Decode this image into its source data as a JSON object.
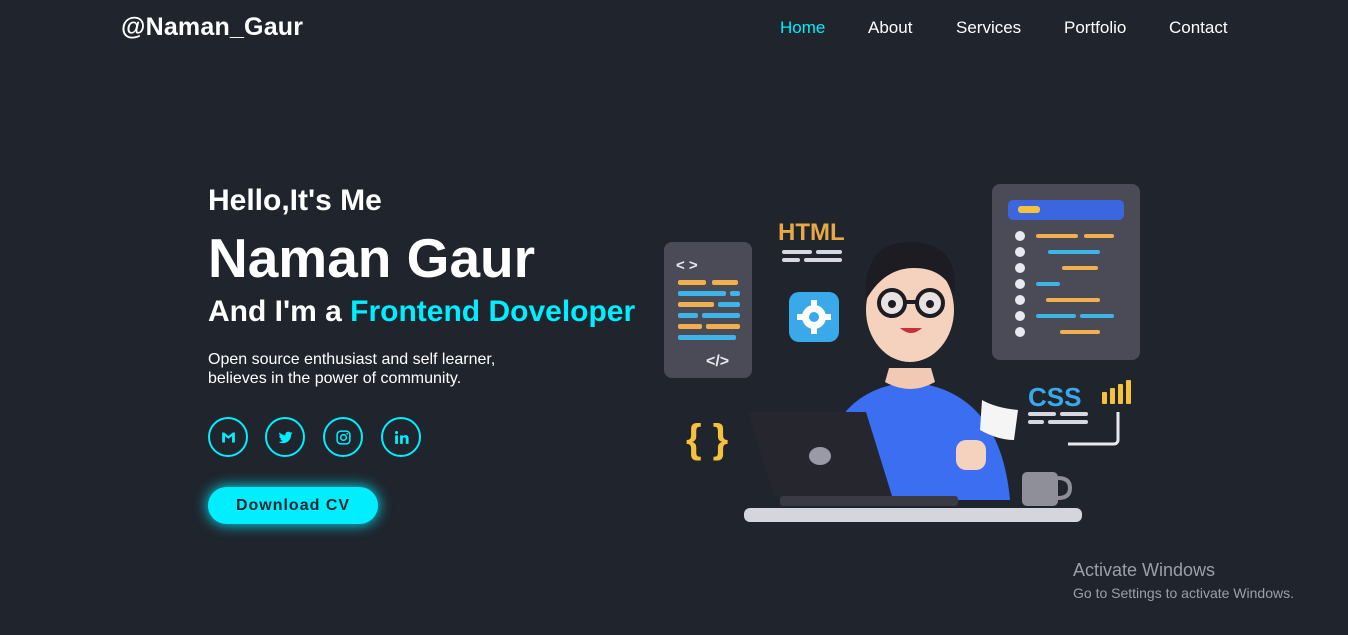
{
  "logo": "@Naman_Gaur",
  "nav": {
    "items": [
      "Home",
      "About",
      "Services",
      "Portfolio",
      "Contact"
    ],
    "active": "Home"
  },
  "hero": {
    "greeting": "Hello,It's Me",
    "name": "Naman Gaur",
    "role_prefix": "And I'm a ",
    "role_highlight": "Frontend Doveloper",
    "description_line1": "Open source enthusiast and self learner,",
    "description_line2": "believes in the power of community.",
    "social_icons": [
      "gmail-icon",
      "twitter-icon",
      "instagram-icon",
      "linkedin-icon"
    ],
    "download_button": "Download CV"
  },
  "illustration": {
    "html_label": "HTML",
    "css_label": "CSS",
    "code_open": "< >",
    "code_close": "</>",
    "braces": "{ }"
  },
  "watermark": {
    "title": "Activate Windows",
    "subtitle": "Go to Settings to activate Windows."
  },
  "colors": {
    "background": "#1f242d",
    "accent": "#00eeff",
    "text": "#ffffff"
  }
}
